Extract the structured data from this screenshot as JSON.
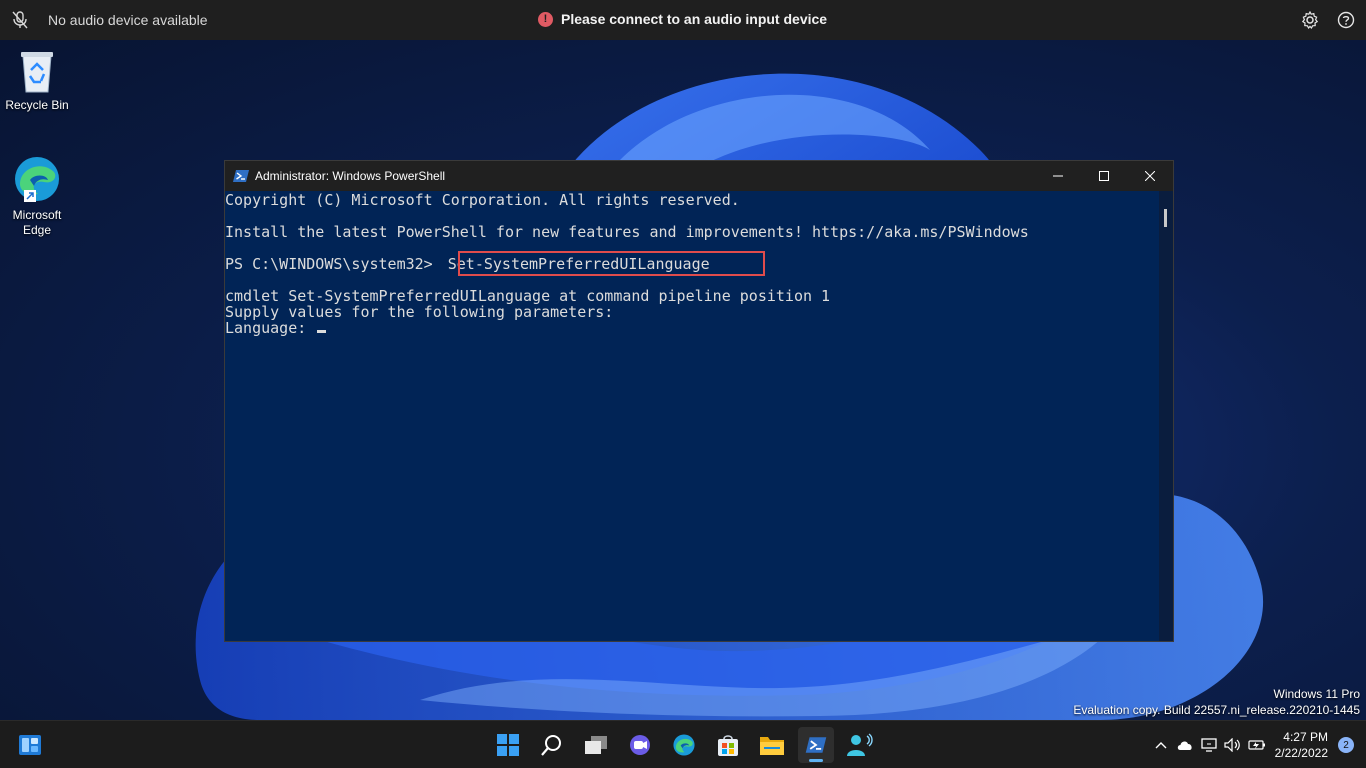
{
  "topbar": {
    "audio_status": "No audio device available",
    "warning_message": "Please connect to an audio input device",
    "warning_symbol": "!"
  },
  "desktop": {
    "icons": [
      {
        "label": "Recycle Bin",
        "icon": "recycle-bin-icon"
      },
      {
        "label": "Microsoft Edge",
        "icon": "edge-icon"
      }
    ]
  },
  "powershell": {
    "title": "Administrator: Windows PowerShell",
    "lines": {
      "copyright": "Copyright (C) Microsoft Corporation. All rights reserved.",
      "install": "Install the latest PowerShell for new features and improvements! https://aka.ms/PSWindows",
      "prompt": "PS C:\\WINDOWS\\system32> ",
      "command": "Set-SystemPreferredUILanguage",
      "cmdlet_info": "cmdlet Set-SystemPreferredUILanguage at command pipeline position 1",
      "supply": "Supply values for the following parameters:",
      "language_prompt": "Language: "
    },
    "highlight_color": "#e04c4c",
    "background_color": "#012456"
  },
  "watermark": {
    "edition": "Windows 11 Pro",
    "build": "Evaluation copy. Build 22557.ni_release.220210-1445"
  },
  "taskbar": {
    "apps": [
      "widgets",
      "start",
      "search",
      "task-view",
      "chat",
      "edge",
      "store",
      "file-explorer",
      "powershell",
      "people"
    ],
    "active_app": "powershell",
    "clock": {
      "time": "4:27 PM",
      "date": "2/22/2022"
    },
    "notification_count": "2",
    "accent_color": "#5fb2f2"
  }
}
